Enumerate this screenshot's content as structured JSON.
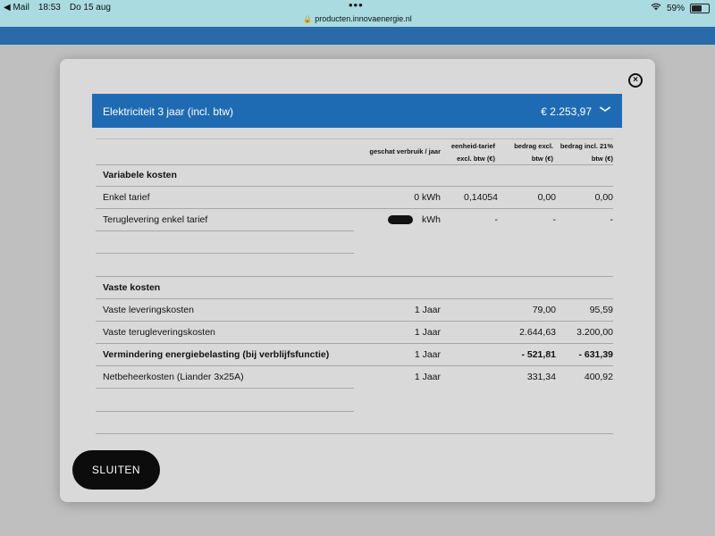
{
  "statusbar": {
    "back_app": "◀ Mail",
    "time": "18:53",
    "date": "Do 15 aug",
    "dots": "•••",
    "url": "producten.innovaenergie.nl",
    "battery": "59%"
  },
  "modal": {
    "close_symbol": "×",
    "accordion": {
      "title": "Elektriciteit 3 jaar (incl. btw)",
      "price": "€ 2.253,97",
      "chevron": "⌄"
    },
    "headers": {
      "usage": "geschat verbruik / jaar",
      "unit_rate_l1": "eenheid-tarief",
      "unit_rate_l2": "excl. btw (€)",
      "excl_l1": "bedrag excl.",
      "excl_l2": "btw (€)",
      "incl_l1": "bedrag incl. 21%",
      "incl_l2": "btw (€)"
    },
    "variable_section": "Variabele kosten",
    "rows_variable": [
      {
        "label": "Enkel tarief",
        "usage": "0 kWh",
        "rate": "0,14054",
        "excl": "0,00",
        "incl": "0,00"
      },
      {
        "label": "Teruglevering enkel tarief",
        "usage": "kWh",
        "rate": "-",
        "excl": "-",
        "incl": "-"
      }
    ],
    "fixed_section": "Vaste kosten",
    "rows_fixed": [
      {
        "label": "Vaste leveringskosten",
        "usage": "1 Jaar",
        "rate": "",
        "excl": "79,00",
        "incl": "95,59"
      },
      {
        "label": "Vaste terugleveringskosten",
        "usage": "1 Jaar",
        "rate": "",
        "excl": "2.644,63",
        "incl": "3.200,00"
      },
      {
        "label": "Vermindering energiebelasting (bij verblijfsfunctie)",
        "usage": "1 Jaar",
        "rate": "",
        "excl": "- 521,81",
        "incl": "- 631,39"
      },
      {
        "label": "Netbeheerkosten (Liander 3x25A)",
        "usage": "1 Jaar",
        "rate": "",
        "excl": "331,34",
        "incl": "400,92"
      }
    ],
    "close_button": "SLUITEN"
  }
}
